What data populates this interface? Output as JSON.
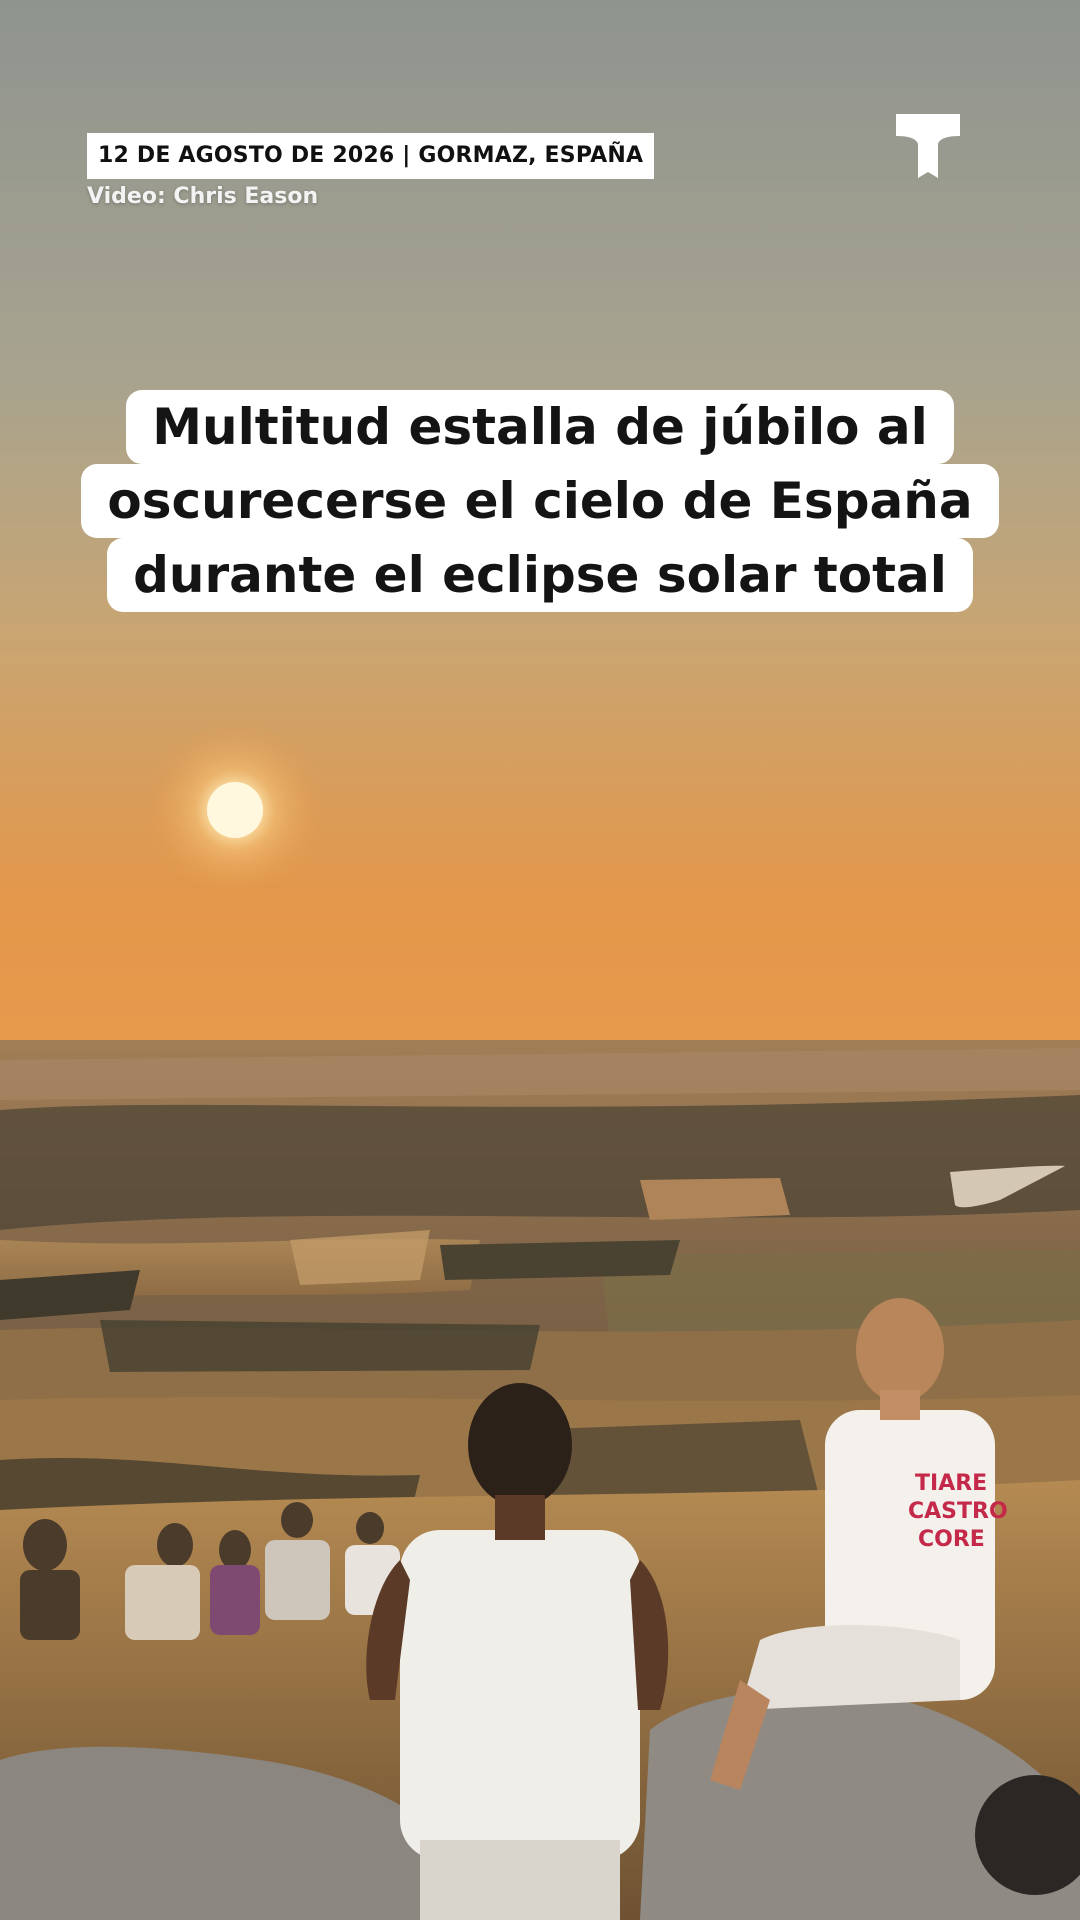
{
  "overlay": {
    "date_location": "12 DE AGOSTO DE 2026 | GORMAZ, ESPAÑA",
    "credit": "Video:  Chris Eason",
    "headline_lines": [
      "Multitud estalla de júbilo al",
      "oscurecerse el cielo de España",
      "durante el eclipse solar total"
    ]
  },
  "icons": {
    "brand_logo": "telemundo-t-logo-icon"
  },
  "colors": {
    "sky_top": "#8f948f",
    "sky_horizon": "#e69a48",
    "sun": "#fff6d6",
    "tag_background": "#ffffff",
    "headline_background": "#ffffff",
    "headline_text": "#141414"
  }
}
